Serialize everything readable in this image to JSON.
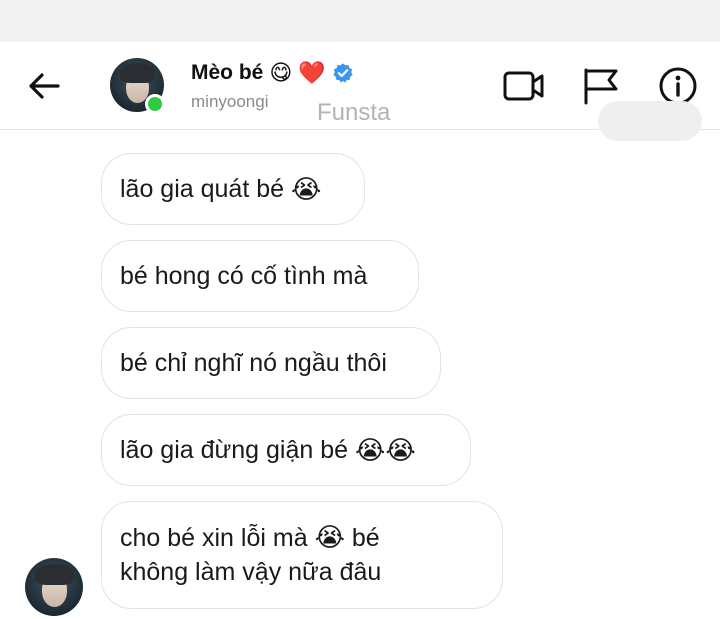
{
  "header": {
    "name": "Mèo bé",
    "name_emoji_1": "😋",
    "name_emoji_2": "❤️",
    "username": "minyoongi",
    "account_label": "Funsta",
    "online": true
  },
  "icons": {
    "back": "arrow-left-icon",
    "verified": "verified-badge-icon",
    "video": "video-camera-icon",
    "flag": "flag-icon",
    "info": "info-icon"
  },
  "colors": {
    "verified": "#3897f0",
    "online": "#2ecc40",
    "bubble_border": "#e3e3e3",
    "muted_text": "#8a8a8a"
  },
  "messages": [
    {
      "text": "lão gia quát bé",
      "emoji": "😭"
    },
    {
      "text": "bé hong có cố tình mà",
      "emoji": ""
    },
    {
      "text": "bé chỉ nghĩ nó ngầu thôi",
      "emoji": ""
    },
    {
      "text": "lão gia đừng giận bé",
      "emoji": "😭😭"
    },
    {
      "text_before": "cho bé xin lỗi mà",
      "emoji": "😭",
      "text_after": "bé",
      "line2": "không làm vậy nữa đâu"
    }
  ]
}
